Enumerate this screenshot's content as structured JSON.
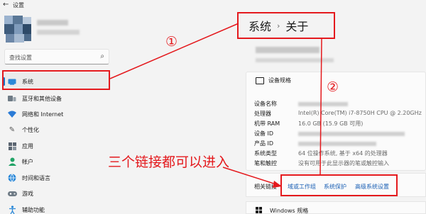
{
  "window": {
    "title": "设置"
  },
  "search": {
    "placeholder": "查找设置"
  },
  "sidebar": {
    "items": [
      {
        "label": "系统",
        "icon": "display-icon"
      },
      {
        "label": "蓝牙和其他设备",
        "icon": "bluetooth-icon"
      },
      {
        "label": "网络和 Internet",
        "icon": "wifi-icon"
      },
      {
        "label": "个性化",
        "icon": "brush-icon"
      },
      {
        "label": "应用",
        "icon": "apps-icon"
      },
      {
        "label": "帐户",
        "icon": "account-icon"
      },
      {
        "label": "时间和语言",
        "icon": "globe-icon"
      },
      {
        "label": "游戏",
        "icon": "gamepad-icon"
      },
      {
        "label": "辅助功能",
        "icon": "accessibility-icon"
      }
    ]
  },
  "breadcrumb": {
    "parent": "系统",
    "separator": "›",
    "current": "关于"
  },
  "device_specs": {
    "title": "设备规格",
    "rows": [
      {
        "key": "设备名称",
        "value": ""
      },
      {
        "key": "处理器",
        "value": "Intel(R) Core(TM) i7-8750H CPU @ 2.20GHz"
      },
      {
        "key": "机带 RAM",
        "value": "16.0 GB (15.9 GB 可用)"
      },
      {
        "key": "设备 ID",
        "value": ""
      },
      {
        "key": "产品 ID",
        "value": ""
      },
      {
        "key": "系统类型",
        "value": "64 位操作系统, 基于 x64 的处理器"
      },
      {
        "key": "笔和触控",
        "value": "没有可用于此显示器的笔或触控输入"
      }
    ]
  },
  "related_links": {
    "label": "相关链接",
    "links": [
      "域或工作组",
      "系统保护",
      "高级系统设置"
    ]
  },
  "windows_spec": {
    "title": "Windows 规格"
  },
  "annotations": {
    "num1": "①",
    "num2": "②",
    "note": "三个链接都可以进入"
  },
  "colors": {
    "accent": "#1a73c8",
    "annotation": "#e4191d",
    "link": "#1a5fb4"
  }
}
